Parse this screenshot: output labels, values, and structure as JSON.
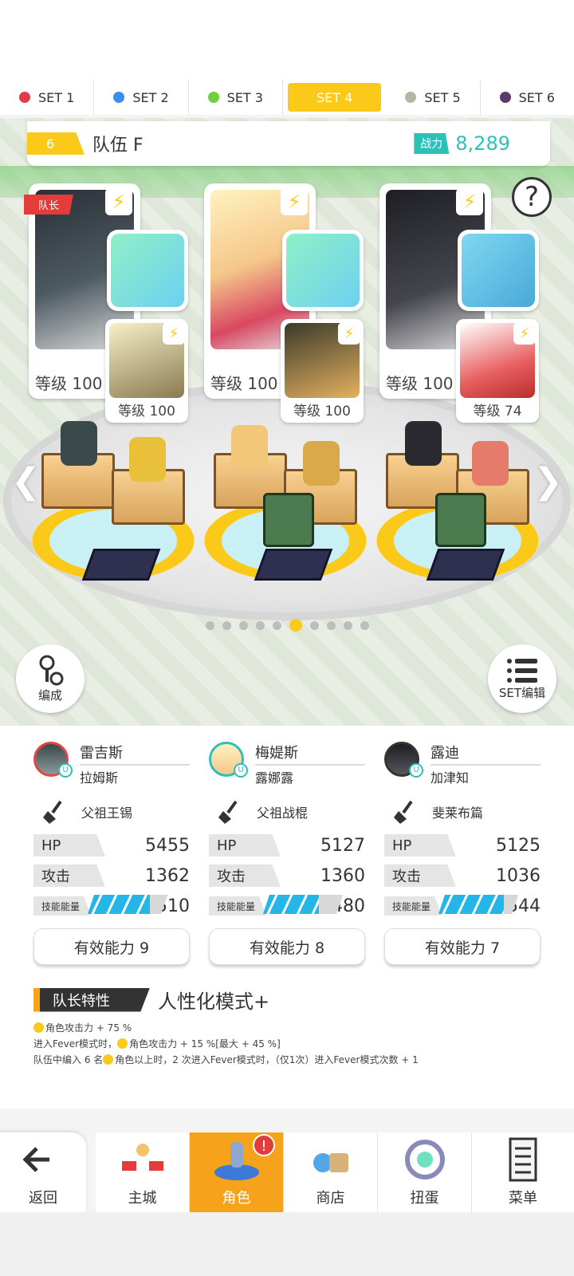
{
  "set_tabs": [
    {
      "label": "SET 1",
      "color": "#e53a4a",
      "active": false
    },
    {
      "label": "SET 2",
      "color": "#3b8df0",
      "active": false
    },
    {
      "label": "SET 3",
      "color": "#6cd23a",
      "active": false
    },
    {
      "label": "SET 4",
      "color": "#ffffff",
      "active": true
    },
    {
      "label": "SET 5",
      "color": "#b6b6a0",
      "active": false
    },
    {
      "label": "SET 6",
      "color": "#5b3a6a",
      "active": false
    }
  ],
  "team": {
    "number": "6",
    "name": "队伍 F",
    "power_label": "战力",
    "power_value": "8,289"
  },
  "characters": [
    {
      "level": "等级 100",
      "leader_tag": "队长",
      "sub_level": "等级 100"
    },
    {
      "level": "等级 100",
      "sub_level": "等级 100"
    },
    {
      "level": "等级 100",
      "sub_level": "等级 74"
    }
  ],
  "help_icon": "?",
  "buttons": {
    "formation_label": "编成",
    "set_edit_label": "SET编辑"
  },
  "page_dots": {
    "count": 10,
    "active_index": 5
  },
  "members": [
    {
      "name": "雷吉斯",
      "sub_name": "拉姆斯",
      "weapon": "父祖王锡",
      "hp_label": "HP",
      "hp": "5455",
      "atk_label": "攻击",
      "atk": "1362",
      "energy_label": "技能能量",
      "energy": "510",
      "ability": "有效能力 9",
      "avatar_color": "#e44444"
    },
    {
      "name": "梅媞斯",
      "sub_name": "露娜露",
      "weapon": "父祖战棍",
      "hp_label": "HP",
      "hp": "5127",
      "atk_label": "攻击",
      "atk": "1360",
      "energy_label": "技能能量",
      "energy": "480",
      "ability": "有效能力 8",
      "avatar_color": "#2bc0b8"
    },
    {
      "name": "露迪",
      "sub_name": "加津知",
      "weapon": "斐莱布篇",
      "hp_label": "HP",
      "hp": "5125",
      "atk_label": "攻击",
      "atk": "1036",
      "energy_label": "技能能量",
      "energy": "544",
      "ability": "有效能力 7",
      "avatar_color": "#333333"
    }
  ],
  "leader": {
    "label": "队长特性",
    "skill": "人性化模式+",
    "line1": "角色攻击力 + 75 %",
    "line2a": "进入Fever模式时，",
    "line2b": "角色攻击力 + 15 %[最大 + 45 %]",
    "line3a": "队伍中编入 6 名",
    "line3b": "角色以上时，2 次进入Fever模式时，（仅1次）进入Fever模式次数 + 1"
  },
  "nav": {
    "back": "返回",
    "items": [
      "主城",
      "角色",
      "商店",
      "扭蛋",
      "菜单"
    ],
    "active": "角色",
    "alert": "!"
  },
  "colors": {
    "accent": "#fbc91a",
    "teal": "#2bc0b8",
    "orange": "#f7a21b",
    "energy": "#23b6e6"
  }
}
